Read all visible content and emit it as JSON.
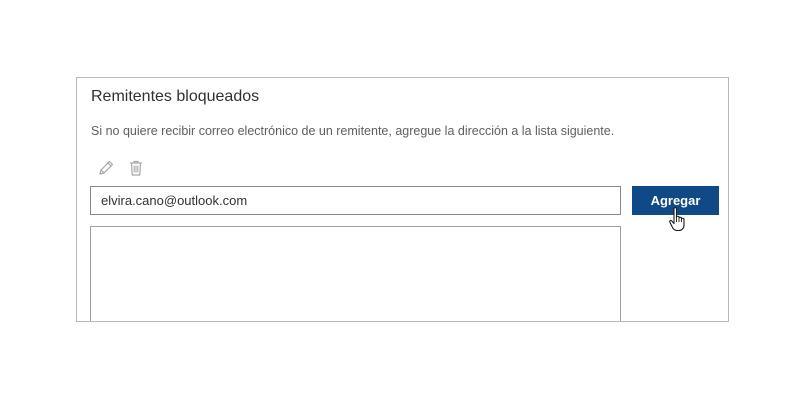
{
  "blocked_senders": {
    "title": "Remitentes bloqueados",
    "description": "Si no quiere recibir correo electrónico de un remitente, agregue la dirección a la lista siguiente.",
    "toolbar": {
      "edit_icon": "pencil-icon",
      "delete_icon": "trash-icon"
    },
    "email_input": {
      "value": "elvira.cano@outlook.com",
      "placeholder": ""
    },
    "add_button_label": "Agregar",
    "list_items": []
  },
  "colors": {
    "accent": "#0f4a86",
    "text_primary": "#323130",
    "text_secondary": "#605e5c"
  }
}
